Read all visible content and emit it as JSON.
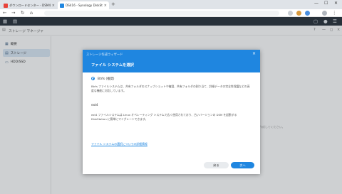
{
  "browser": {
    "tabs": [
      {
        "title": "ダウンロードセンター - DSM4u | Sy",
        "favicon_color": "#e8433b"
      },
      {
        "title": "DS416 - Synology DiskStation",
        "favicon_color": "#1f86e0"
      }
    ],
    "new_tab": "+",
    "controls": {
      "minimize": "—",
      "maximize": "☐",
      "close": "✕"
    },
    "nav": {
      "back": "←",
      "forward": "→",
      "reload": "↻",
      "home": "⌂"
    }
  },
  "app": {
    "title": "ストレージ マネージャ",
    "sidebar": [
      {
        "label": "概要",
        "icon": "▦"
      },
      {
        "label": "ストレージ",
        "icon": "▤"
      },
      {
        "label": "HDD/SSD",
        "icon": "▭"
      }
    ],
    "background_note": "ボリュームを作成してください。"
  },
  "dialog": {
    "wizard_title": "ストレージ作成ウィザード",
    "step_title": "ファイル システムを選択",
    "close": "×",
    "options": [
      {
        "label": "Btrfs (推奨)",
        "selected": true,
        "description": "Btrfs ファイルシステムは、共有フォルダのスナップショットや複製、共有フォルダの割り当て、詳細データの完全性保護などの高度な機能に対応しています。"
      },
      {
        "label": "ext4",
        "selected": false,
        "description": "ext4 ファイルシステムは Linux オペレーティング システムで広く使用されており、古いバージョンの DSM を起動する DiskStation に簡単にマイグレートできます。"
      }
    ],
    "help_link": "ファイル システムの選択についての詳細情報",
    "back_button": "戻る",
    "next_button": "次へ"
  },
  "colors": {
    "accent": "#1f86e0",
    "dsm_bar": "#29323b"
  }
}
